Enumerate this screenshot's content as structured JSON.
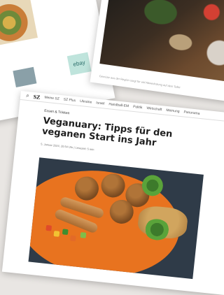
{
  "left_card": {
    "ad_label": "ebay"
  },
  "right_card": {
    "caption": "Gemüse aus der Region sorgt für viel Abwechslung auf dem Teller"
  },
  "article": {
    "nav": {
      "logo": "SZ",
      "items": [
        "Meine SZ",
        "SZ Plus",
        "Ukraine",
        "Israel",
        "Handball-EM",
        "Politik",
        "Wirtschaft",
        "Meinung",
        "Panorama"
      ]
    },
    "section": "Essen & Trinken",
    "headline": "Veganuary: Tipps für den veganen Start ins Jahr",
    "meta": "5. Januar 2024, 20:54 Uhr   |   Lesezeit: 5 min"
  }
}
